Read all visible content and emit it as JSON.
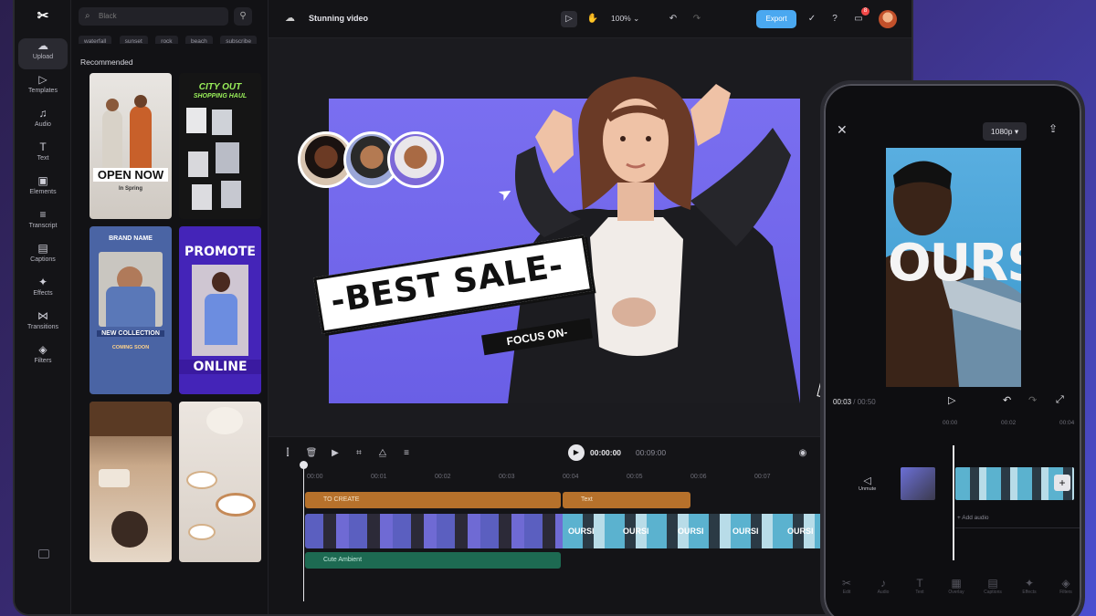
{
  "app": {
    "logo_text": "✂",
    "project_title": "Stunning video",
    "zoom": "100%",
    "export_label": "Export",
    "notification_count": "8"
  },
  "rail": {
    "items": [
      {
        "label": "Upload",
        "icon": "upload-icon",
        "glyph": "☁"
      },
      {
        "label": "Templates",
        "icon": "templates-icon",
        "glyph": "▷"
      },
      {
        "label": "Audio",
        "icon": "audio-icon",
        "glyph": "♫"
      },
      {
        "label": "Text",
        "icon": "text-icon",
        "glyph": "T"
      },
      {
        "label": "Elements",
        "icon": "elements-icon",
        "glyph": "▣"
      },
      {
        "label": "Transcript",
        "icon": "transcript-icon",
        "glyph": "≡"
      },
      {
        "label": "Captions",
        "icon": "captions-icon",
        "glyph": "▤"
      },
      {
        "label": "Effects",
        "icon": "effects-icon",
        "glyph": "✦"
      },
      {
        "label": "Transitions",
        "icon": "transitions-icon",
        "glyph": "⋈"
      },
      {
        "label": "Filters",
        "icon": "filters-icon",
        "glyph": "◈"
      }
    ]
  },
  "panel": {
    "search_placeholder": "Black",
    "chips": [
      "waterfall",
      "sunset",
      "rock",
      "beach",
      "subscribe"
    ],
    "recommended_label": "Recommended",
    "cards": {
      "open_now": "OPEN NOW",
      "open_now_sub": "In Spring",
      "city_out": "CITY OUT",
      "shopping_haul": "SHOPPING HAUL",
      "brand_name": "BRAND NAME",
      "new_collection": "NEW COLLECTION",
      "coming_soon": "COMING SOON",
      "promote": "PROMOTE",
      "online": "ONLINE"
    }
  },
  "canvas": {
    "sale_text": "-BEST SALE-",
    "focus_text": "FOCUS ON-"
  },
  "timeline": {
    "current_time": "00:00:00",
    "total_time": "00:09:00",
    "ruler": [
      "00:00",
      "00:01",
      "00:02",
      "00:03",
      "00:04",
      "00:05",
      "00:06",
      "00:07"
    ],
    "text_track_1": "TO CREATE",
    "text_track_2": "Text",
    "audio_track": "Cute Ambient"
  },
  "phone": {
    "resolution": "1080p ▾",
    "overlay_text": "OURSI",
    "time_current": "00:03",
    "time_total": "00:50",
    "ruler": [
      "00:00",
      "00:02",
      "00:04"
    ],
    "unmute_label": "Unmute",
    "add_audio": "+ Add audio",
    "bottom_tools": [
      {
        "label": "Edit",
        "icon": "scissors-icon",
        "glyph": "✂"
      },
      {
        "label": "Audio",
        "icon": "audio-icon",
        "glyph": "♪"
      },
      {
        "label": "Text",
        "icon": "text-icon",
        "glyph": "T"
      },
      {
        "label": "Overlay",
        "icon": "overlay-icon",
        "glyph": "▦"
      },
      {
        "label": "Captions",
        "icon": "captions-icon",
        "glyph": "▤"
      },
      {
        "label": "Effects",
        "icon": "effects-icon",
        "glyph": "✦"
      },
      {
        "label": "Filters",
        "icon": "filters-icon",
        "glyph": "◈"
      }
    ]
  },
  "colors": {
    "export": "#4aa8f0",
    "canvas_bg": "#6f64ec",
    "text_track": "#b6712b",
    "audio_track": "#1d6a52"
  }
}
